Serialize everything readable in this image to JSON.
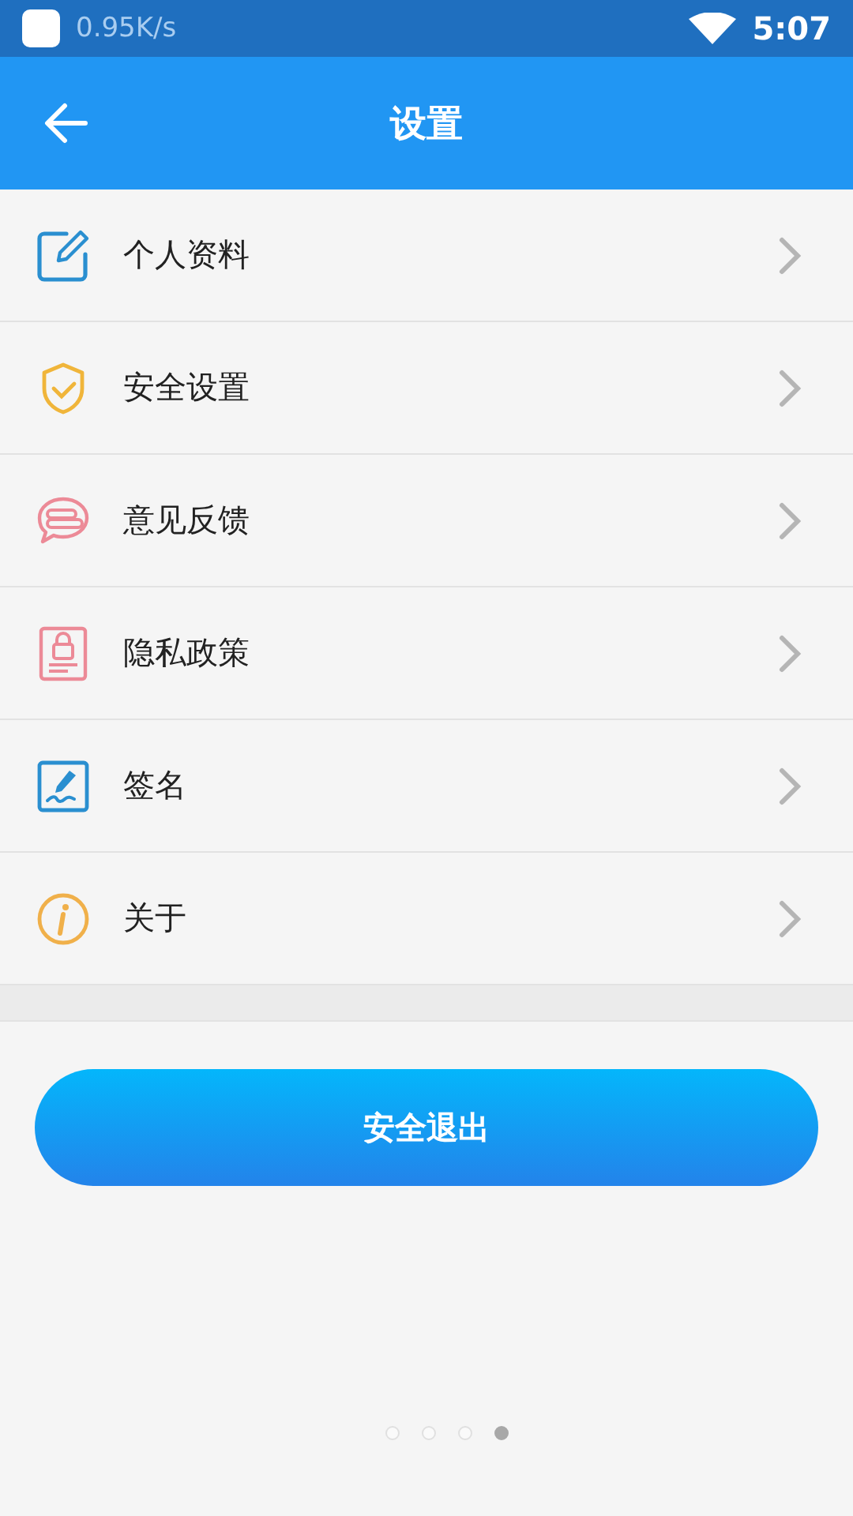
{
  "status_bar": {
    "speed": "0.95K/s",
    "time": "5:07"
  },
  "app_bar": {
    "title": "设置"
  },
  "menu": [
    {
      "label": "个人资料"
    },
    {
      "label": "安全设置"
    },
    {
      "label": "意见反馈"
    },
    {
      "label": "隐私政策"
    },
    {
      "label": "签名"
    },
    {
      "label": "关于"
    }
  ],
  "logout_button": "安全退出",
  "pager": [
    {
      "selected": false
    },
    {
      "selected": false
    },
    {
      "selected": false
    },
    {
      "selected": true
    }
  ]
}
